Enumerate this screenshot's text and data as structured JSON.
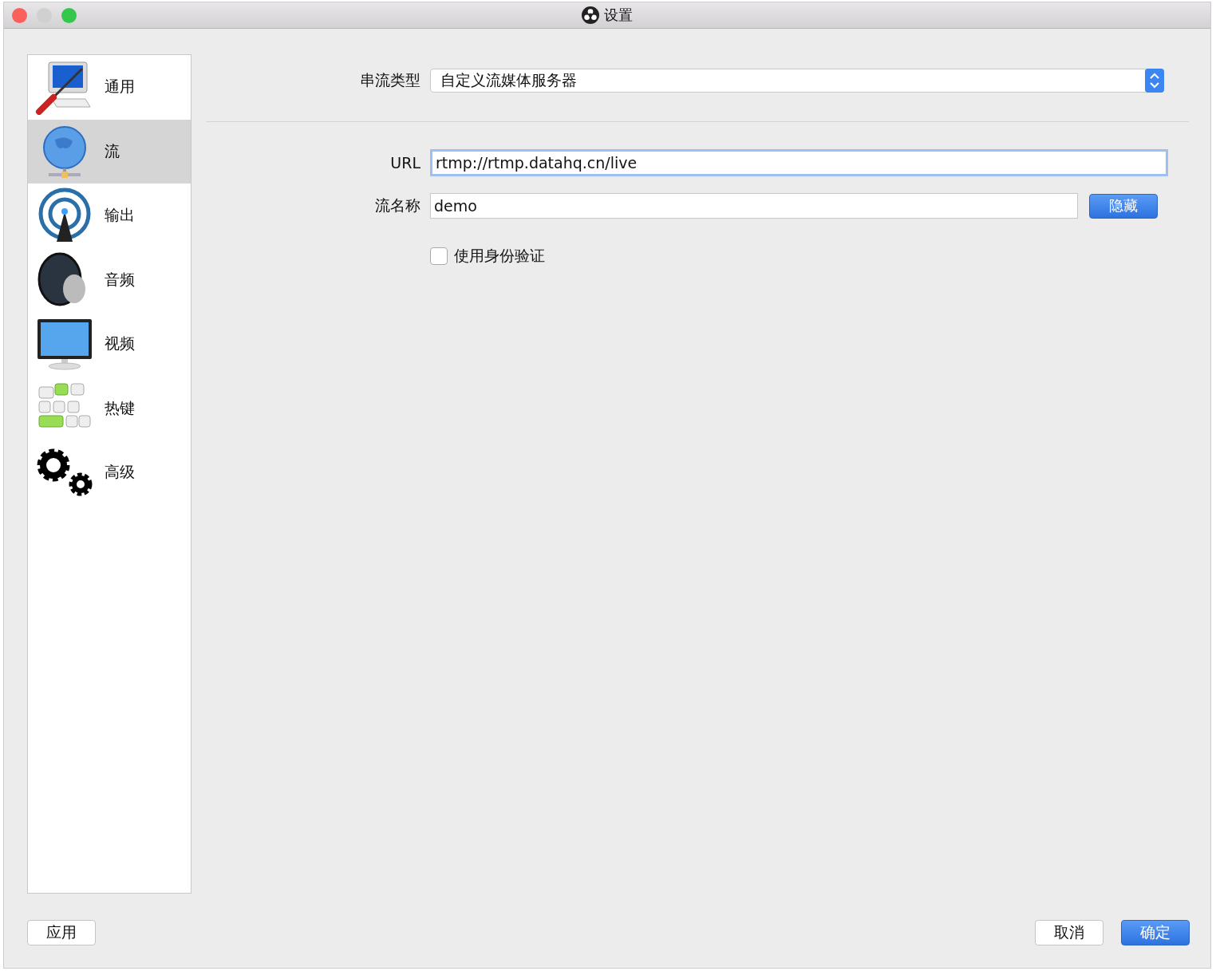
{
  "window": {
    "title": "设置"
  },
  "sidebar": {
    "items": [
      {
        "label": "通用",
        "kind": "general",
        "selected": false
      },
      {
        "label": "流",
        "kind": "stream",
        "selected": true
      },
      {
        "label": "输出",
        "kind": "output",
        "selected": false
      },
      {
        "label": "音频",
        "kind": "audio",
        "selected": false
      },
      {
        "label": "视频",
        "kind": "video",
        "selected": false
      },
      {
        "label": "热键",
        "kind": "hotkeys",
        "selected": false
      },
      {
        "label": "高级",
        "kind": "advanced",
        "selected": false
      }
    ]
  },
  "service": {
    "label": "串流类型",
    "value": "自定义流媒体服务器"
  },
  "url": {
    "label": "URL",
    "value": "rtmp://rtmp.datahq.cn/live",
    "focused": true
  },
  "stream_key": {
    "label": "流名称",
    "value": "demo",
    "button": "隐藏"
  },
  "auth": {
    "label": "使用身份验证",
    "checked": false
  },
  "buttons": {
    "apply": "应用",
    "cancel": "取消",
    "ok": "确定"
  }
}
